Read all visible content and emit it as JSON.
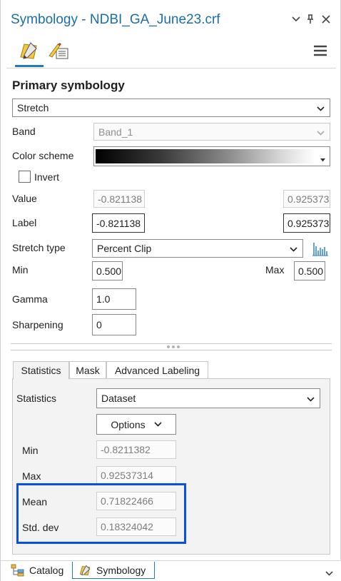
{
  "window": {
    "title": "Symbology - NDBI_GA_June23.crf",
    "menu_icon": "chevron-down-icon",
    "pin_icon": "pin-icon",
    "close_icon": "close-icon"
  },
  "toolbar": {
    "tabs": [
      {
        "icon": "primary-symbology-icon",
        "active": true
      },
      {
        "icon": "secondary-symbology-icon",
        "active": false
      }
    ],
    "hamburger_icon": "hamburger-menu-icon"
  },
  "primary": {
    "heading": "Primary symbology",
    "renderer": "Stretch",
    "band_label": "Band",
    "band_value": "Band_1",
    "color_scheme_label": "Color scheme",
    "invert_label": "Invert",
    "value_label": "Value",
    "value_min": "-0.821138",
    "value_max": "0.925373",
    "label_label": "Label",
    "label_min": "-0.821138",
    "label_max": "0.925373",
    "stretch_type_label": "Stretch type",
    "stretch_type_value": "Percent Clip",
    "min_label": "Min",
    "min_value": "0.500",
    "max_label": "Max",
    "max_value": "0.500",
    "gamma_label": "Gamma",
    "gamma_value": "1.0",
    "sharpening_label": "Sharpening",
    "sharpening_value": "0"
  },
  "tabs": {
    "statistics": "Statistics",
    "mask": "Mask",
    "advanced_labeling": "Advanced Labeling"
  },
  "statistics": {
    "statistics_label": "Statistics",
    "statistics_value": "Dataset",
    "options_button": "Options",
    "min_label": "Min",
    "min_value": "-0.8211382",
    "max_label": "Max",
    "max_value": "0.92537314",
    "mean_label": "Mean",
    "mean_value": "0.71822466",
    "std_label": "Std. dev",
    "std_value": "0.18324042"
  },
  "bottom_tabs": {
    "catalog": "Catalog",
    "symbology": "Symbology"
  },
  "colors": {
    "accent": "#1f7ac2",
    "title": "#1a6fa8",
    "highlight": "#0a4fe0"
  }
}
